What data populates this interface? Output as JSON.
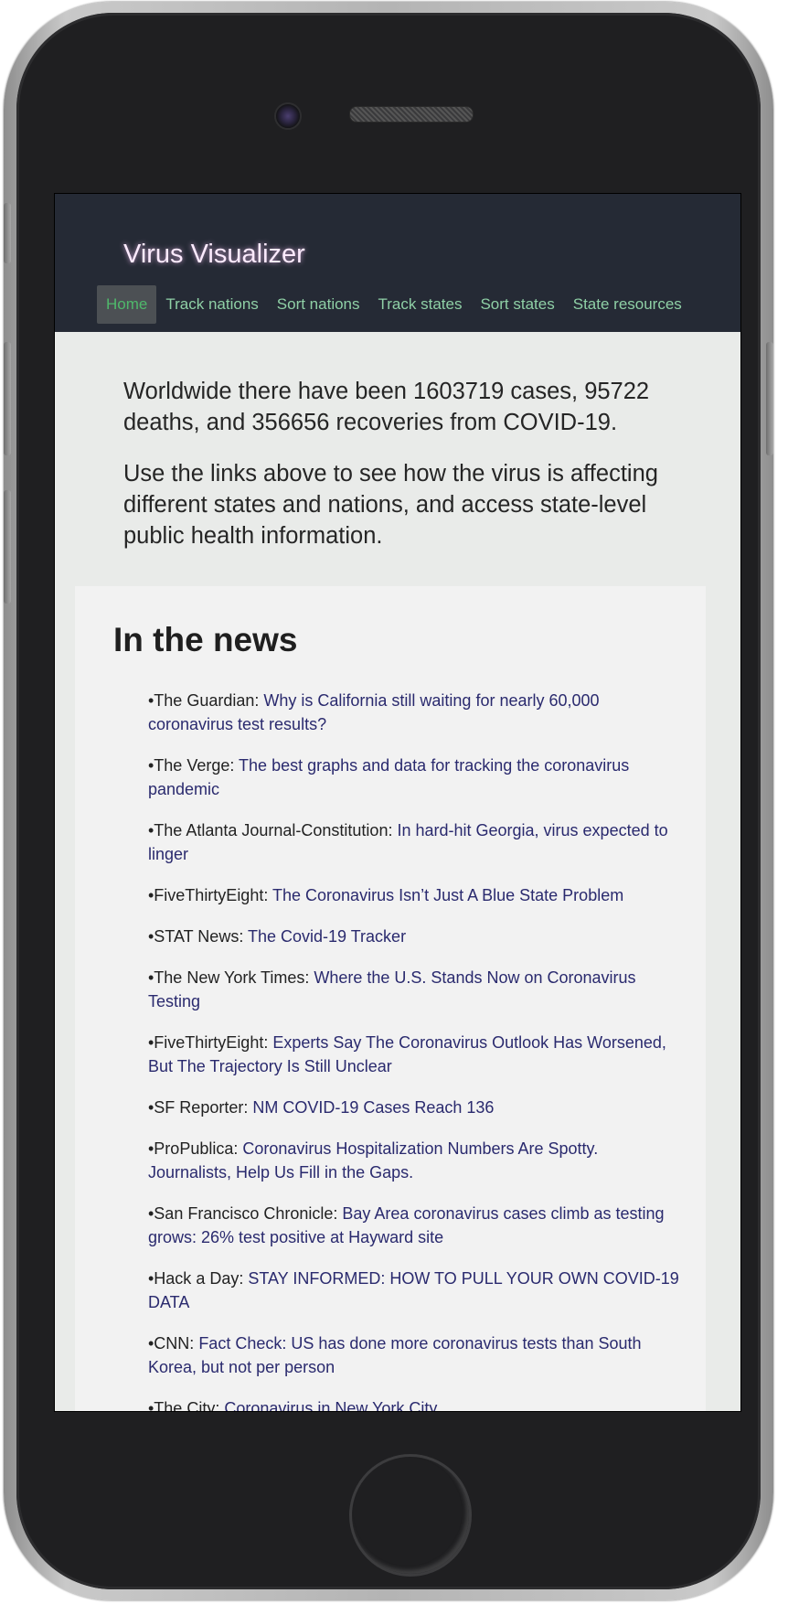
{
  "site": {
    "title": "Virus Visualizer"
  },
  "nav": [
    {
      "label": "Home",
      "active": true
    },
    {
      "label": "Track nations",
      "active": false
    },
    {
      "label": "Sort nations",
      "active": false
    },
    {
      "label": "Track states",
      "active": false
    },
    {
      "label": "Sort states",
      "active": false
    },
    {
      "label": "State resources",
      "active": false
    }
  ],
  "intro": {
    "summary": "Worldwide there have been 1603719 cases, 95722 deaths, and 356656 recoveries from COVID-19.",
    "instructions": "Use the links above to see how the virus is affecting different states and nations, and access state-level public health information."
  },
  "news": {
    "heading": "In the news",
    "items": [
      {
        "source": "•The Guardian: ",
        "headline": "Why is California still waiting for nearly 60,000 coronavirus test results?"
      },
      {
        "source": "•The Verge: ",
        "headline": "The best graphs and data for tracking the coronavirus pandemic"
      },
      {
        "source": "•The Atlanta Journal-Constitution: ",
        "headline": "In hard-hit Georgia, virus expected to linger"
      },
      {
        "source": "•FiveThirtyEight: ",
        "headline": "The Coronavirus Isn’t Just A Blue State Problem"
      },
      {
        "source": "•STAT News: ",
        "headline": "The Covid-19 Tracker"
      },
      {
        "source": "•The New York Times: ",
        "headline": "Where the U.S. Stands Now on Coronavirus Testing"
      },
      {
        "source": "•FiveThirtyEight: ",
        "headline": "Experts Say The Coronavirus Outlook Has Worsened, But The Trajectory Is Still Unclear"
      },
      {
        "source": "•SF Reporter: ",
        "headline": "NM COVID-19 Cases Reach 136"
      },
      {
        "source": "•ProPublica: ",
        "headline": "Coronavirus Hospitalization Numbers Are Spotty. Journalists, Help Us Fill in the Gaps."
      },
      {
        "source": "•San Francisco Chronicle: ",
        "headline": "Bay Area coronavirus cases climb as testing grows: 26% test positive at Hayward site"
      },
      {
        "source": "•Hack a Day: ",
        "headline": "STAY INFORMED: HOW TO PULL YOUR OWN COVID-19 DATA"
      },
      {
        "source": "•CNN: ",
        "headline": "Fact Check: US has done more coronavirus tests than South Korea, but not per person"
      },
      {
        "source": "•The City: ",
        "headline": "Coronavirus in New York City"
      }
    ]
  }
}
